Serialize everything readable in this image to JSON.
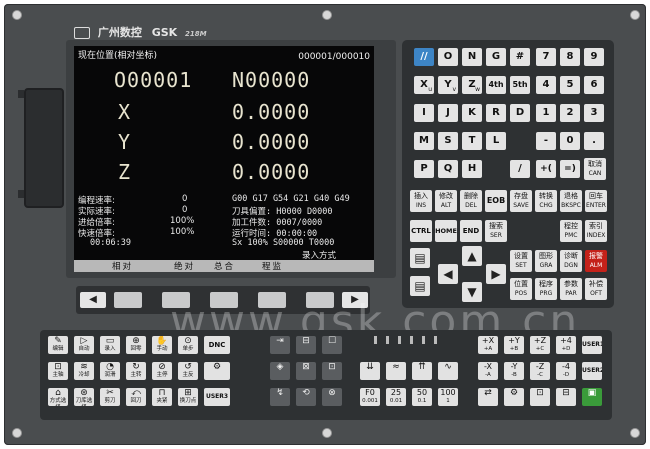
{
  "brand": {
    "name": "广州数控",
    "logo_text": "GSK",
    "model": "218M"
  },
  "screen": {
    "title": "现在位置(相对坐标)",
    "counter": "000001/000010",
    "program": "O00001",
    "block": "N00000",
    "axes": [
      {
        "label": "X",
        "value": "0.0000"
      },
      {
        "label": "Y",
        "value": "0.0000"
      },
      {
        "label": "Z",
        "value": "0.0000"
      }
    ],
    "left_rows": [
      {
        "label": "编程速率:",
        "value": "0"
      },
      {
        "label": "实际速率:",
        "value": "0"
      },
      {
        "label": "进给倍率:",
        "value": "100%"
      },
      {
        "label": "快速倍率:",
        "value": "100%"
      }
    ],
    "time": "00:06:39",
    "right_rows": [
      "G00 G17 G54 G21 G40 G49",
      "刀具偏置: H0000  D0000",
      "加工件数: 0007/0000",
      "运行时间: 00:00:00",
      "Sx  100%  S00000  T0000"
    ],
    "input_mode": "录入方式",
    "softkeys": [
      "相对",
      "绝对",
      "总合",
      "程监"
    ]
  },
  "keypad": {
    "row1": [
      "//",
      "O",
      "N",
      "G",
      "#",
      "7",
      "8",
      "9"
    ],
    "row2": [
      "X",
      "Y",
      "Z",
      "4th",
      "5th",
      "4",
      "5",
      "6"
    ],
    "row2_sub": [
      "u",
      "v",
      "w",
      "",
      "",
      "",
      "",
      ""
    ],
    "row3": [
      "I",
      "J",
      "K",
      "R",
      "D",
      "1",
      "2",
      "3"
    ],
    "row4": [
      "M",
      "S",
      "T",
      "L",
      "-",
      "0",
      "."
    ],
    "row5": [
      "P",
      "Q",
      "H",
      "/",
      "+(",
      "=)"
    ],
    "cancel": {
      "cn": "取消",
      "en": "CAN"
    },
    "func1": [
      {
        "cn": "插入",
        "en": "INS"
      },
      {
        "cn": "修改",
        "en": "ALT"
      },
      {
        "cn": "删除",
        "en": "DEL"
      },
      {
        "cn": "EOB",
        "en": ""
      },
      {
        "cn": "存盘",
        "en": "SAVE"
      },
      {
        "cn": "转换",
        "en": "CHG"
      },
      {
        "cn": "退格",
        "en": "BKSPC"
      },
      {
        "cn": "回车",
        "en": "ENTER"
      }
    ],
    "func2": [
      {
        "cn": "CTRL",
        "en": ""
      },
      {
        "cn": "HOME",
        "en": ""
      },
      {
        "cn": "END",
        "en": ""
      },
      {
        "cn": "搜索",
        "en": "SER"
      },
      {
        "cn": "程控",
        "en": "PMC"
      },
      {
        "cn": "索引",
        "en": "INDEX"
      }
    ],
    "func3": [
      {
        "cn": "设置",
        "en": "SET"
      },
      {
        "cn": "图形",
        "en": "GRA"
      },
      {
        "cn": "诊断",
        "en": "DGN"
      },
      {
        "cn": "报警",
        "en": "ALM"
      }
    ],
    "func4": [
      {
        "cn": "位置",
        "en": "POS"
      },
      {
        "cn": "程序",
        "en": "PRG"
      },
      {
        "cn": "参数",
        "en": "PAR"
      },
      {
        "cn": "补偿",
        "en": "OFT"
      }
    ]
  },
  "watermark": "www.gsk.com.cn",
  "operator": {
    "mode_row1": [
      "编辑",
      "自动",
      "录入",
      "回零",
      "手动",
      "单步",
      "DNC"
    ],
    "mode_row2": [
      "主轴",
      "冷却",
      "润滑",
      "主转",
      "主停",
      "主反",
      ""
    ],
    "mode_row3": [
      "方式选择",
      "刀库选择",
      "剪刀",
      "回刀",
      "夹紧",
      "换刀点",
      "USER3"
    ],
    "jog": [
      "+X",
      "+Y",
      "+Z",
      "+4",
      "-X",
      "-Y",
      "-Z",
      "-4"
    ],
    "jog_sub": [
      "+A",
      "+B",
      "+C",
      "+D",
      "-A",
      "-B",
      "-C",
      "-D"
    ],
    "user": [
      "USER1",
      "USER2"
    ],
    "rapid": [
      "F0",
      "25",
      "50",
      "100"
    ],
    "rapid_sub": [
      "0.001",
      "0.01",
      "0.1",
      "1"
    ],
    "indicators": [
      "X",
      "Y",
      "Z",
      "4th",
      "OUT",
      "TOL"
    ]
  }
}
